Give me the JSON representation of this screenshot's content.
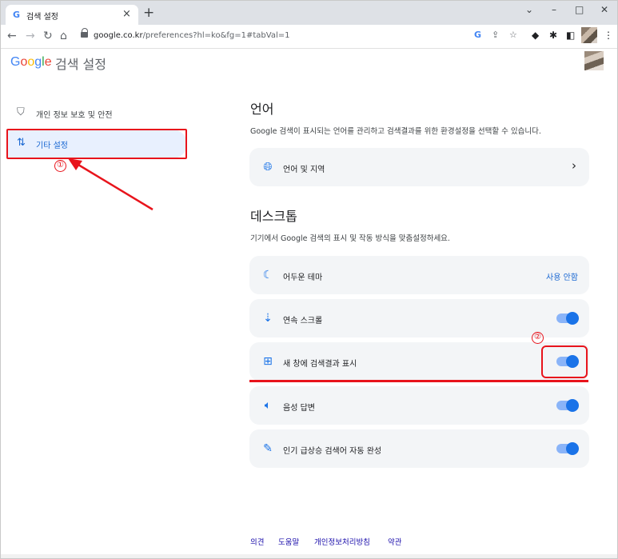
{
  "browser": {
    "tab_favicon": "G",
    "tab_title": "검색 설정",
    "tab_close": "×",
    "new_tab": "+",
    "win_min": "–",
    "win_max": "□",
    "win_close": "✕",
    "win_chevron": "⌄",
    "url_host": "google.co.kr",
    "url_path": "/preferences?hl=ko&fg=1#tabVal=1"
  },
  "header": {
    "logo": "Google",
    "title": "검색 설정"
  },
  "sidebar": {
    "items": [
      {
        "label": "개인 정보 보호 및 안전",
        "icon": "shield-icon"
      },
      {
        "label": "기타 설정",
        "icon": "sliders-icon"
      }
    ]
  },
  "annotations": {
    "marker1": "①",
    "marker2": "②"
  },
  "language_section": {
    "title": "언어",
    "description": "Google 검색이 표시되는 언어를 관리하고 검색결과를 위한 환경설정을 선택할 수 있습니다.",
    "row_label": "언어 및 지역"
  },
  "desktop_section": {
    "title": "데스크톱",
    "description": "기기에서 Google 검색의 표시 및 작동 방식을 맞춤설정하세요.",
    "rows": [
      {
        "label": "어두운 테마",
        "value": "사용 안함",
        "icon": "moon-icon"
      },
      {
        "label": "연속 스크롤",
        "toggle": true,
        "icon": "continuous-scroll-icon"
      },
      {
        "label": "새 창에 검색결과 표시",
        "toggle": true,
        "icon": "new-window-icon"
      },
      {
        "label": "음성 답변",
        "toggle": true,
        "icon": "speaker-icon"
      },
      {
        "label": "인기 급상승 검색어 자동 완성",
        "toggle": true,
        "icon": "magic-wand-icon"
      }
    ]
  },
  "footer": {
    "links": [
      "의견",
      "도움말",
      "개인정보처리방침",
      "약관"
    ]
  },
  "colors": {
    "accent": "#1a73e8",
    "annotation": "#e8141c",
    "active_bg": "#e8f0fe",
    "card_bg": "#f3f5f7"
  }
}
